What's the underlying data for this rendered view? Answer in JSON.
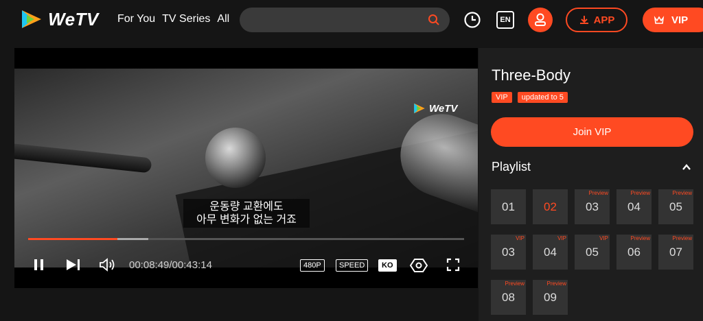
{
  "header": {
    "logo_text": "WeTV",
    "nav": [
      "For You",
      "TV Series",
      "All"
    ],
    "search_placeholder": "",
    "lang_label": "EN",
    "app_label": "APP",
    "vip_label": "VIP",
    "accent": "#ff4a22"
  },
  "player": {
    "watermark": "WeTV",
    "subtitle_lines": [
      "운동량 교환에도",
      "아무 변화가 없는 거죠"
    ],
    "current_time": "00:08:49",
    "duration": "00:43:14",
    "time_display": "00:08:49/00:43:14",
    "played_fraction": 0.204,
    "buffered_fraction": 0.276,
    "quality_label": "480P",
    "speed_label": "SPEED",
    "subtitle_lang_label": "KO",
    "icons": [
      "pause-icon",
      "next-icon",
      "volume-icon",
      "settings-icon",
      "fullscreen-icon"
    ]
  },
  "panel": {
    "title": "Three-Body",
    "badges": [
      "VIP",
      "updated to 5"
    ],
    "join_label": "Join VIP",
    "playlist_label": "Playlist",
    "rows": [
      [
        {
          "label": "01",
          "mark": "",
          "active": false
        },
        {
          "label": "02",
          "mark": "",
          "active": true
        },
        {
          "label": "03",
          "mark": "Preview",
          "active": false
        },
        {
          "label": "04",
          "mark": "Preview",
          "active": false
        },
        {
          "label": "05",
          "mark": "Preview",
          "active": false
        }
      ],
      [
        {
          "label": "03",
          "mark": "VIP",
          "active": false
        },
        {
          "label": "04",
          "mark": "VIP",
          "active": false
        },
        {
          "label": "05",
          "mark": "VIP",
          "active": false
        },
        {
          "label": "06",
          "mark": "Preview",
          "active": false
        },
        {
          "label": "07",
          "mark": "Preview",
          "active": false
        }
      ],
      [
        {
          "label": "08",
          "mark": "Preview",
          "active": false
        },
        {
          "label": "09",
          "mark": "Preview",
          "active": false
        }
      ]
    ]
  }
}
